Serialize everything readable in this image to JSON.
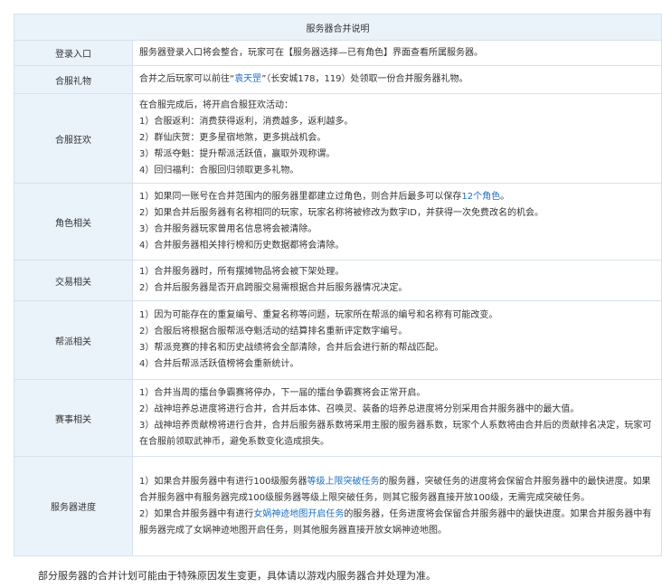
{
  "table": {
    "title": "服务器合并说明",
    "rows": [
      {
        "label": "登录入口",
        "lines": [
          {
            "segments": [
              {
                "text": "服务器登录入口将会整合，玩家可在【服务器选择—已有角色】界面查看所属服务器。"
              }
            ]
          }
        ]
      },
      {
        "label": "合服礼物",
        "lines": [
          {
            "segments": [
              {
                "text": "合并之后玩家可以前往“"
              },
              {
                "text": "袁天罡",
                "link": true
              },
              {
                "text": "”（长安城178，119）处领取一份合并服务器礼物。"
              }
            ]
          }
        ]
      },
      {
        "label": "合服狂欢",
        "lines": [
          {
            "segments": [
              {
                "text": "在合服完成后，将开启合服狂欢活动："
              }
            ]
          },
          {
            "segments": [
              {
                "text": "1）合服返利：消费获得返利，消费越多，返利越多。"
              }
            ]
          },
          {
            "segments": [
              {
                "text": "2）群仙庆贺：更多星宿地煞，更多挑战机会。"
              }
            ]
          },
          {
            "segments": [
              {
                "text": "3）帮派夺魁：提升帮派活跃值，赢取外观称谓。"
              }
            ]
          },
          {
            "segments": [
              {
                "text": "4）回归福利：合服回归领取更多礼物。"
              }
            ]
          }
        ]
      },
      {
        "label": "角色相关",
        "lines": [
          {
            "segments": [
              {
                "text": "1）如果同一账号在合并范围内的服务器里都建立过角色，则合并后最多可以保存"
              },
              {
                "text": "12个角色",
                "link": true
              },
              {
                "text": "。"
              }
            ]
          },
          {
            "segments": [
              {
                "text": "2）如果合并后服务器有名称相同的玩家，玩家名称将被修改为数字ID，并获得一次免费改名的机会。"
              }
            ]
          },
          {
            "segments": [
              {
                "text": "3）合并服务器玩家曾用名信息将会被清除。"
              }
            ]
          },
          {
            "segments": [
              {
                "text": "4）合并服务器相关排行榜和历史数据都将会清除。"
              }
            ]
          }
        ]
      },
      {
        "label": "交易相关",
        "lines": [
          {
            "segments": [
              {
                "text": "1）合并服务器时，所有摆摊物品将会被下架处理。"
              }
            ]
          },
          {
            "segments": [
              {
                "text": "2）合并后服务器是否开启跨服交易需根据合并后服务器情况决定。"
              }
            ]
          }
        ]
      },
      {
        "label": "帮派相关",
        "lines": [
          {
            "segments": [
              {
                "text": "1）因为可能存在的重复编号、重复名称等问题，玩家所在帮派的编号和名称有可能改变。"
              }
            ]
          },
          {
            "segments": [
              {
                "text": "2）合服后将根据合服帮派夺魁活动的结算排名重新评定数字编号。"
              }
            ]
          },
          {
            "segments": [
              {
                "text": "3）帮派竞赛的排名和历史战绩将会全部清除，合并后会进行新的帮战匹配。"
              }
            ]
          },
          {
            "segments": [
              {
                "text": "4）合并后帮派活跃值榜将会重新统计。"
              }
            ]
          }
        ]
      },
      {
        "label": "赛事相关",
        "lines": [
          {
            "segments": [
              {
                "text": "1）合并当周的擂台争霸赛将停办，下一届的擂台争霸赛将会正常开启。"
              }
            ]
          },
          {
            "segments": [
              {
                "text": "2）战神培养总进度将进行合并，合并后本体、召唤灵、装备的培养总进度将分别采用合并服务器中的最大值。"
              }
            ]
          },
          {
            "segments": [
              {
                "text": "3）战神培养贡献榜将进行合并，合并后服务器系数将采用主服的服务器系数，玩家个人系数将由合并后的贡献排名决定，玩家可在合服前领取武神币，避免系数变化造成损失。"
              }
            ],
            "wrap": true
          }
        ]
      },
      {
        "label": "服务器进度",
        "lines": [
          {
            "segments": [
              {
                "text": "1）如果合并服务器中有进行100级服务器"
              },
              {
                "text": "等级上限突破任务",
                "link": true
              },
              {
                "text": "的服务器，突破任务的进度将会保留合并服务器中的最快进度。如果合并服务器中有服务器完成100级服务器等级上限突破任务，则其它服务器直接开放100级，无需完成突破任务。"
              }
            ],
            "wrap": true
          },
          {
            "segments": [
              {
                "text": "2）如果合并服务器中有进行"
              },
              {
                "text": "女娲神迹地图开启任务",
                "link": true
              },
              {
                "text": "的服务器，任务进度将会保留合并服务器中的最快进度。如果合并服务器中有服务器完成了女娲神迹地图开启任务，则其他服务器直接开放女娲神迹地图。"
              }
            ],
            "wrap": true
          }
        ]
      }
    ]
  },
  "footnote": "部分服务器的合并计划可能由于特殊原因发生变更，具体请以游戏内服务器合并处理为准。",
  "colors": {
    "header_bg": "#eaf2fa",
    "border": "#d6e2ee",
    "text": "#333333",
    "link": "#1f6fbf"
  }
}
